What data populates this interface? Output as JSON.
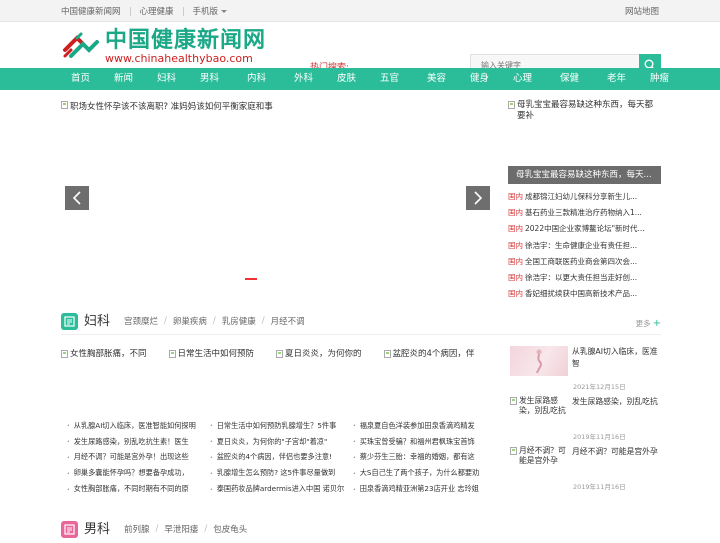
{
  "topbar": {
    "links": [
      "中国健康新闻网",
      "心理健康",
      "手机版"
    ],
    "sitemap": "网站地图"
  },
  "logo": {
    "cn": "中国健康新闻网",
    "en": "www.chinahealthybao.com"
  },
  "hot_search": "热门搜索:",
  "search": {
    "placeholder": "输入关键字"
  },
  "nav": [
    "首页",
    "新闻",
    "妇科",
    "男科",
    "内科",
    "外科",
    "皮肤",
    "五官",
    "美容",
    "健身",
    "心理",
    "保健",
    "老年",
    "肿瘤"
  ],
  "slider": {
    "caption": "职场女性怀孕该不该离职? 准妈妈该如何平衡家庭和事"
  },
  "side": {
    "img_caption": "母乳宝宝最容易缺这种东西，每天都要补",
    "bar_caption": "母乳宝宝最容易缺这种东西，每天...",
    "news": [
      {
        "tag": "国内",
        "title": "成都锦江妇幼儿保科分享新生儿..."
      },
      {
        "tag": "国内",
        "title": "基石药业三款精准治疗药物纳入1..."
      },
      {
        "tag": "国内",
        "title": "2022中国企业家博鳌论坛\"新时代..."
      },
      {
        "tag": "国内",
        "title": "徐浩宇：生命健康企业有责任担..."
      },
      {
        "tag": "国内",
        "title": "全国工商联医药业商会第四次会..."
      },
      {
        "tag": "国内",
        "title": "徐浩宇：以更大责任担当走好创..."
      },
      {
        "tag": "国内",
        "title": "香妃细扰续获中国高新技术产品..."
      }
    ]
  },
  "fuke": {
    "title": "妇科",
    "tabs": [
      "宫颈糜烂",
      "卵巢疾病",
      "乳房健康",
      "月经不调"
    ],
    "more": "更多",
    "thumbs": [
      "女性胸部胀痛，不同",
      "日常生活中如何预防",
      "夏日炎炎，为何你的",
      "盆腔炎的4个病因，伴"
    ],
    "list1": [
      "从乳腺AI切入临床，医准智能如何探明",
      "发生尿路感染，别乱吃抗生素！医生",
      "月经不调？可能是宫外孕！出现这些",
      "卵巢多囊能怀孕吗？想要备孕成功，",
      "女性胸部胀痛，不同时期有不同的原"
    ],
    "list2": [
      "日常生活中如何预防乳腺增生？5件事",
      "夏日炎炎，为何你的\"子宫却\"着凉\"",
      "盆腔炎的4个病因，伴侣也要多注意!",
      "乳腺增生怎么预防? 这5件事尽量做到",
      "泰国药妆品牌ardermis进入中国 诺贝尔"
    ],
    "list3": [
      "福泉夏自色洋装参加田泉香滴鸡精发",
      "买珠宝曾受骗？和福州君枫珠宝首饰",
      "蔡少芬生三胎：幸福的婚姻，都有这",
      "大S自己生了两个孩子，为什么都要劝",
      "田泉香滴鸡精亚洲第23店开业 志玲姐"
    ],
    "cards": [
      {
        "pic_text": "",
        "title": "从乳腺AI切入临床，医准智",
        "date": "2021年12月15日"
      },
      {
        "pic_text": "发生尿路感染，别乱吃抗",
        "title": "发生尿路感染，别乱吃抗",
        "date": "2019年11月16日"
      },
      {
        "pic_text": "月经不调？可能是宫外孕",
        "title": "月经不调？可能是宫外孕",
        "date": "2019年11月16日"
      }
    ]
  },
  "nanke": {
    "title": "男科",
    "tabs": [
      "前列腺",
      "早泄阳痿",
      "包皮龟头"
    ]
  },
  "colors": {
    "accent": "#2bbd99",
    "hot": "#d23535",
    "nanke_icon": "#e8669a"
  }
}
